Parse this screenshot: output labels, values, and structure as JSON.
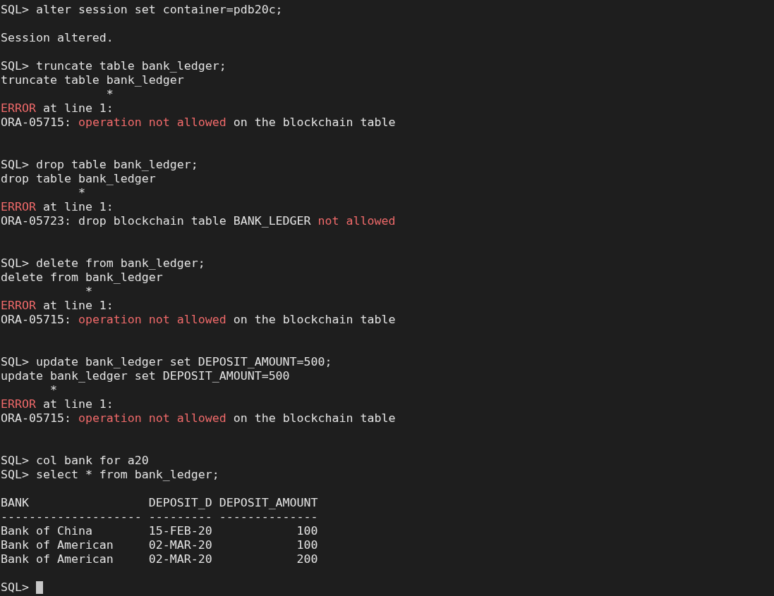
{
  "terminal": {
    "lines": [
      {
        "kind": "text",
        "segments": [
          {
            "text": "SQL> alter session set container=pdb20c;",
            "kind": "normal"
          }
        ]
      },
      {
        "kind": "blank"
      },
      {
        "kind": "text",
        "segments": [
          {
            "text": "Session altered.",
            "kind": "normal"
          }
        ]
      },
      {
        "kind": "blank"
      },
      {
        "kind": "text",
        "segments": [
          {
            "text": "SQL> truncate table bank_ledger;",
            "kind": "normal"
          }
        ]
      },
      {
        "kind": "text",
        "segments": [
          {
            "text": "truncate table bank_ledger",
            "kind": "normal"
          }
        ]
      },
      {
        "kind": "text",
        "segments": [
          {
            "text": "               *",
            "kind": "normal"
          }
        ]
      },
      {
        "kind": "text",
        "segments": [
          {
            "text": "ERROR",
            "kind": "error"
          },
          {
            "text": " at line 1:",
            "kind": "normal"
          }
        ]
      },
      {
        "kind": "text",
        "segments": [
          {
            "text": "ORA-05715: ",
            "kind": "normal"
          },
          {
            "text": "operation not allowed",
            "kind": "error"
          },
          {
            "text": " on the blockchain table",
            "kind": "normal"
          }
        ]
      },
      {
        "kind": "blank"
      },
      {
        "kind": "blank"
      },
      {
        "kind": "text",
        "segments": [
          {
            "text": "SQL> drop table bank_ledger;",
            "kind": "normal"
          }
        ]
      },
      {
        "kind": "text",
        "segments": [
          {
            "text": "drop table bank_ledger",
            "kind": "normal"
          }
        ]
      },
      {
        "kind": "text",
        "segments": [
          {
            "text": "           *",
            "kind": "normal"
          }
        ]
      },
      {
        "kind": "text",
        "segments": [
          {
            "text": "ERROR",
            "kind": "error"
          },
          {
            "text": " at line 1:",
            "kind": "normal"
          }
        ]
      },
      {
        "kind": "text",
        "segments": [
          {
            "text": "ORA-05723: drop blockchain table BANK_LEDGER ",
            "kind": "normal"
          },
          {
            "text": "not allowed",
            "kind": "error"
          }
        ]
      },
      {
        "kind": "blank"
      },
      {
        "kind": "blank"
      },
      {
        "kind": "text",
        "segments": [
          {
            "text": "SQL> delete from bank_ledger;",
            "kind": "normal"
          }
        ]
      },
      {
        "kind": "text",
        "segments": [
          {
            "text": "delete from bank_ledger",
            "kind": "normal"
          }
        ]
      },
      {
        "kind": "text",
        "segments": [
          {
            "text": "            *",
            "kind": "normal"
          }
        ]
      },
      {
        "kind": "text",
        "segments": [
          {
            "text": "ERROR",
            "kind": "error"
          },
          {
            "text": " at line 1:",
            "kind": "normal"
          }
        ]
      },
      {
        "kind": "text",
        "segments": [
          {
            "text": "ORA-05715: ",
            "kind": "normal"
          },
          {
            "text": "operation not allowed",
            "kind": "error"
          },
          {
            "text": " on the blockchain table",
            "kind": "normal"
          }
        ]
      },
      {
        "kind": "blank"
      },
      {
        "kind": "blank"
      },
      {
        "kind": "text",
        "segments": [
          {
            "text": "SQL> update bank_ledger set DEPOSIT_AMOUNT=500;",
            "kind": "normal"
          }
        ]
      },
      {
        "kind": "text",
        "segments": [
          {
            "text": "update bank_ledger set DEPOSIT_AMOUNT=500",
            "kind": "normal"
          }
        ]
      },
      {
        "kind": "text",
        "segments": [
          {
            "text": "       *",
            "kind": "normal"
          }
        ]
      },
      {
        "kind": "text",
        "segments": [
          {
            "text": "ERROR",
            "kind": "error"
          },
          {
            "text": " at line 1:",
            "kind": "normal"
          }
        ]
      },
      {
        "kind": "text",
        "segments": [
          {
            "text": "ORA-05715: ",
            "kind": "normal"
          },
          {
            "text": "operation not allowed",
            "kind": "error"
          },
          {
            "text": " on the blockchain table",
            "kind": "normal"
          }
        ]
      },
      {
        "kind": "blank"
      },
      {
        "kind": "blank"
      },
      {
        "kind": "text",
        "segments": [
          {
            "text": "SQL> col bank for a20",
            "kind": "normal"
          }
        ]
      },
      {
        "kind": "text",
        "segments": [
          {
            "text": "SQL> select * from bank_ledger;",
            "kind": "normal"
          }
        ]
      },
      {
        "kind": "blank"
      },
      {
        "kind": "text",
        "segments": [
          {
            "text": "BANK                 DEPOSIT_D DEPOSIT_AMOUNT",
            "kind": "normal"
          }
        ]
      },
      {
        "kind": "text",
        "segments": [
          {
            "text": "-------------------- --------- --------------",
            "kind": "normal"
          }
        ]
      },
      {
        "kind": "text",
        "segments": [
          {
            "text": "Bank of China        15-FEB-20            100",
            "kind": "normal"
          }
        ]
      },
      {
        "kind": "text",
        "segments": [
          {
            "text": "Bank of American     02-MAR-20            100",
            "kind": "normal"
          }
        ]
      },
      {
        "kind": "text",
        "segments": [
          {
            "text": "Bank of American     02-MAR-20            200",
            "kind": "normal"
          }
        ]
      },
      {
        "kind": "blank"
      },
      {
        "kind": "prompt",
        "segments": [
          {
            "text": "SQL> ",
            "kind": "normal"
          }
        ],
        "cursor": true
      }
    ]
  }
}
